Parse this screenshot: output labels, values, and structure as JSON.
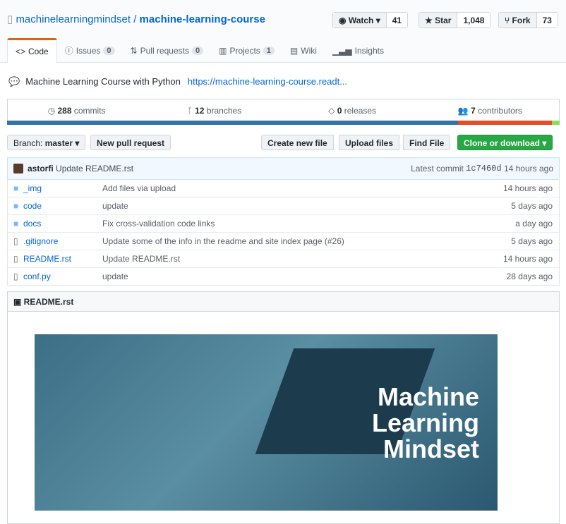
{
  "repo": {
    "owner": "machinelearningmindset",
    "sep": "/",
    "name": "machine-learning-course"
  },
  "actions": {
    "watch": "Watch ▾",
    "watch_count": "41",
    "star": "★ Star",
    "star_count": "1,048",
    "fork": "Fork",
    "fork_count": "73"
  },
  "tabs": [
    {
      "label": "Code"
    },
    {
      "label": "Issues",
      "count": "0"
    },
    {
      "label": "Pull requests",
      "count": "0"
    },
    {
      "label": "Projects",
      "count": "1"
    },
    {
      "label": "Wiki"
    },
    {
      "label": "Insights"
    }
  ],
  "description": {
    "text": "Machine Learning Course with Python",
    "link": "https://machine-learning-course.readt..."
  },
  "stats": {
    "commits": "288",
    "commits_label": "commits",
    "branches": "12",
    "branches_label": "branches",
    "releases": "0",
    "releases_label": "releases",
    "contributors": "7",
    "contributors_label": "contributors"
  },
  "languages": [
    {
      "pct": 81.6,
      "color": "#3572A5"
    },
    {
      "pct": 17,
      "color": "#e34c26"
    },
    {
      "pct": 1.4,
      "color": "#89e051"
    }
  ],
  "toolbar": {
    "branch_label": "Branch:",
    "branch": "master ▾",
    "new_pr": "New pull request",
    "create": "Create new file",
    "upload": "Upload files",
    "find": "Find File",
    "clone": "Clone or download ▾"
  },
  "commit": {
    "author": "astorfi",
    "message": "Update README.rst",
    "latest": "Latest commit",
    "sha": "1c7460d",
    "age": "14 hours ago"
  },
  "files": [
    {
      "type": "dir",
      "name": "_img",
      "msg": "Add files via upload",
      "age": "14 hours ago"
    },
    {
      "type": "dir",
      "name": "code",
      "msg": "update",
      "age": "5 days ago"
    },
    {
      "type": "dir",
      "name": "docs",
      "msg": "Fix cross-validation code links",
      "age": "a day ago"
    },
    {
      "type": "file",
      "name": ".gitignore",
      "msg": "Update some of the info in the readme and site index page (#26)",
      "age": "5 days ago"
    },
    {
      "type": "file",
      "name": "README.rst",
      "msg": "Update README.rst",
      "age": "14 hours ago"
    },
    {
      "type": "file",
      "name": "conf.py",
      "msg": "update",
      "age": "28 days ago"
    }
  ],
  "readme": {
    "title": "README.rst",
    "banner": [
      "Machine",
      "Learning",
      "Mindset"
    ]
  }
}
